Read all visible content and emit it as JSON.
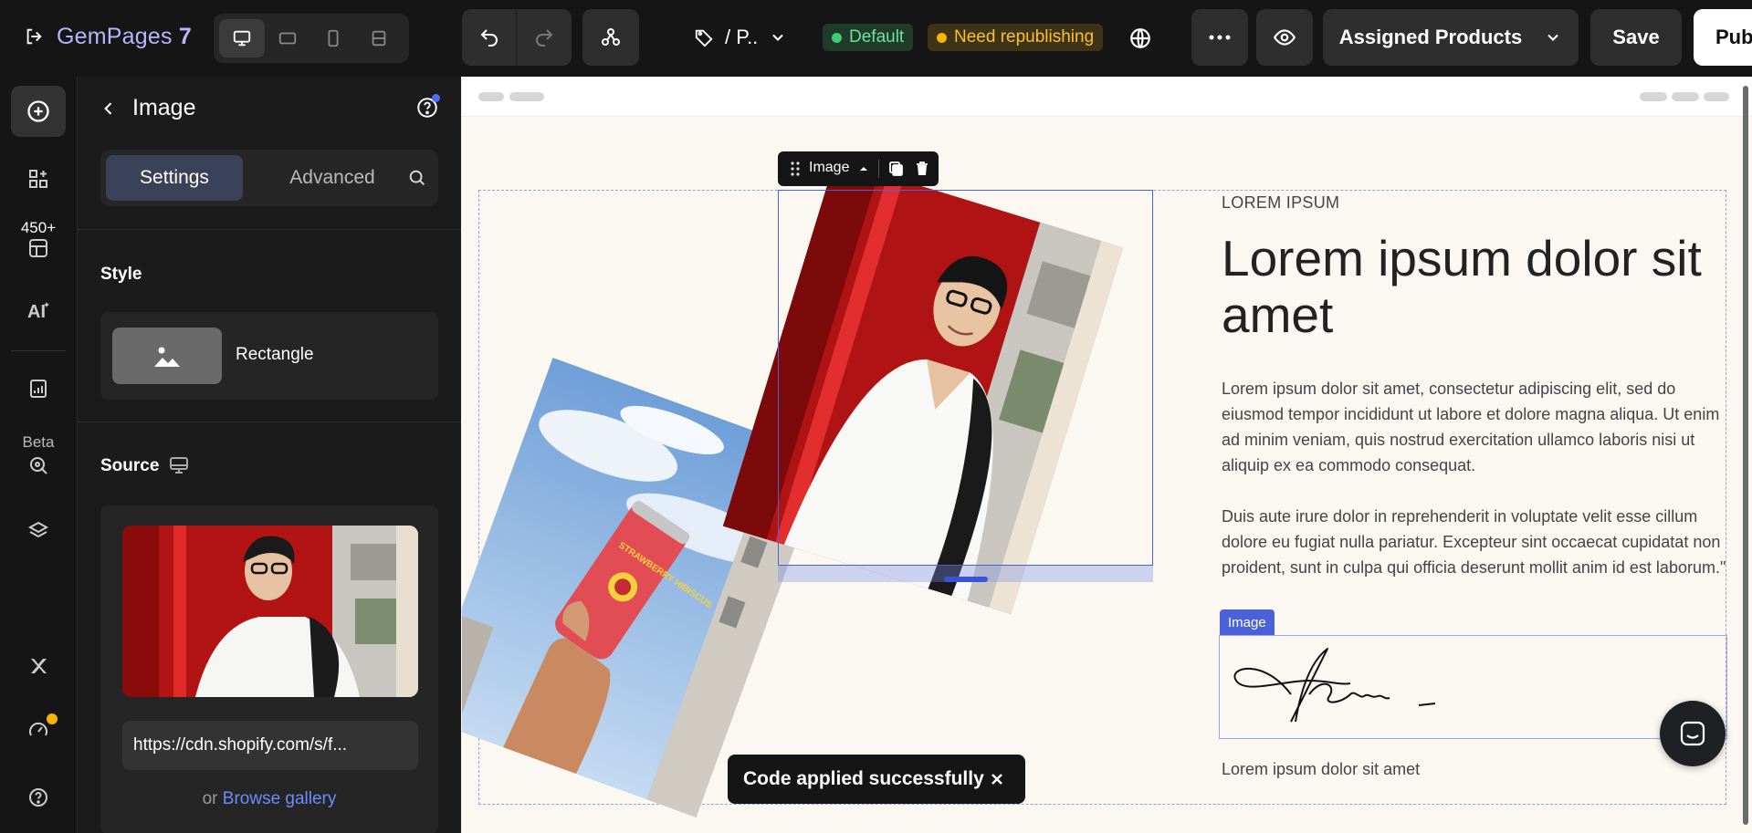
{
  "app": {
    "name": "GemPages",
    "version": "7",
    "page_label": "/ P..",
    "status_default": "Default",
    "status_republish": "Need republishing",
    "assigned_products": "Assigned Products",
    "save": "Save",
    "publish": "Pub",
    "colors": {
      "accent": "#4a62d8",
      "brand": "#b9b4ff",
      "published_green": "#3ccf73",
      "warning_yellow": "#f5b400"
    }
  },
  "rail": {
    "templates_count": "450+",
    "beta_label": "Beta",
    "ai_label": "AI"
  },
  "panel": {
    "title": "Image",
    "tabs": [
      "Settings",
      "Advanced"
    ],
    "style_section": "Style",
    "style_option": "Rectangle",
    "source_section": "Source",
    "url_value": "https://cdn.shopify.com/s/f...",
    "browse_prefix": "or",
    "browse_link": "Browse gallery"
  },
  "canvas": {
    "toolbar_label": "Image",
    "eyebrow": "LOREM IPSUM",
    "heading": "Lorem ipsum dolor sit amet",
    "paragraph1": "Lorem ipsum dolor sit amet, consectetur adipiscing elit, sed do eiusmod tempor incididunt ut labore et dolore magna aliqua. Ut enim ad minim veniam, quis nostrud exercitation ullamco laboris nisi ut aliquip ex ea commodo consequat.",
    "paragraph2": "Duis aute irure dolor in reprehenderit in voluptate velit esse cillum dolore eu fugiat nulla pariatur. Excepteur sint occaecat cupidatat non proident, sunt in culpa qui officia deserunt mollit anim id est laborum.\"",
    "signature_label": "Image",
    "caption": "Lorem ipsum dolor sit amet",
    "can_text": "STRAWBERRY HIBISCUS"
  },
  "toast": {
    "message": "Code applied successfully"
  }
}
